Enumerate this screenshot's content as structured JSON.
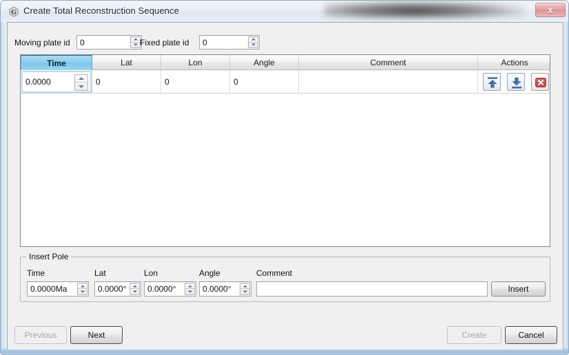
{
  "window": {
    "title": "Create Total Reconstruction Sequence",
    "app_icon": "gplates-g-icon",
    "close_label": "x",
    "frame_color": "#cbdaec"
  },
  "form": {
    "moving_plate_label": "Moving plate id",
    "moving_plate_value": "0",
    "fixed_plate_label": "Fixed plate id",
    "fixed_plate_value": "0"
  },
  "table": {
    "selected_column": "Time",
    "selected_header_color": "#8ccfee",
    "columns": [
      {
        "label": "Time",
        "key": "time"
      },
      {
        "label": "Lat",
        "key": "lat"
      },
      {
        "label": "Lon",
        "key": "lon"
      },
      {
        "label": "Angle",
        "key": "angle"
      },
      {
        "label": "Comment",
        "key": "comment"
      },
      {
        "label": "Actions",
        "key": "actions"
      }
    ],
    "rows": [
      {
        "time": "0.0000",
        "lat": "0",
        "lon": "0",
        "angle": "0",
        "comment": "",
        "actions": [
          "move-up-icon",
          "move-down-icon",
          "delete-icon"
        ]
      }
    ]
  },
  "insert_pole": {
    "group_title": "Insert Pole",
    "fields": [
      {
        "label": "Time",
        "value": "0.0000Ma"
      },
      {
        "label": "Lat",
        "value": "0.0000°"
      },
      {
        "label": "Lon",
        "value": "0.0000°"
      },
      {
        "label": "Angle",
        "value": "0.0000°"
      }
    ],
    "comment_label": "Comment",
    "comment_value": "",
    "comment_placeholder": "",
    "insert_label": "Insert"
  },
  "footer": {
    "previous_label": "Previous",
    "previous_enabled": false,
    "next_label": "Next",
    "next_enabled": true,
    "create_label": "Create",
    "create_enabled": false,
    "cancel_label": "Cancel",
    "cancel_enabled": true
  }
}
